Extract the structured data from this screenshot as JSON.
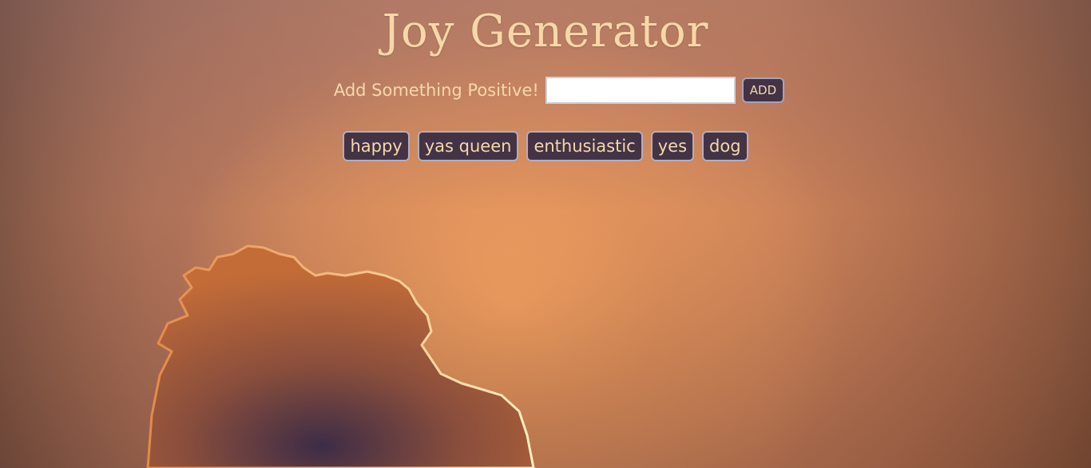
{
  "app": {
    "title": "Joy Generator"
  },
  "form": {
    "label": "Add Something Positive!",
    "input_value": "",
    "input_placeholder": "",
    "add_button_label": "ADD"
  },
  "topics": [
    {
      "label": "happy"
    },
    {
      "label": "yas queen"
    },
    {
      "label": "enthusiastic"
    },
    {
      "label": "yes"
    },
    {
      "label": "dog"
    }
  ],
  "colors": {
    "title_text": "#f7d7a8",
    "button_bg": "#433345",
    "button_border": "#b2aebd",
    "button_text": "#f6d7ab"
  }
}
